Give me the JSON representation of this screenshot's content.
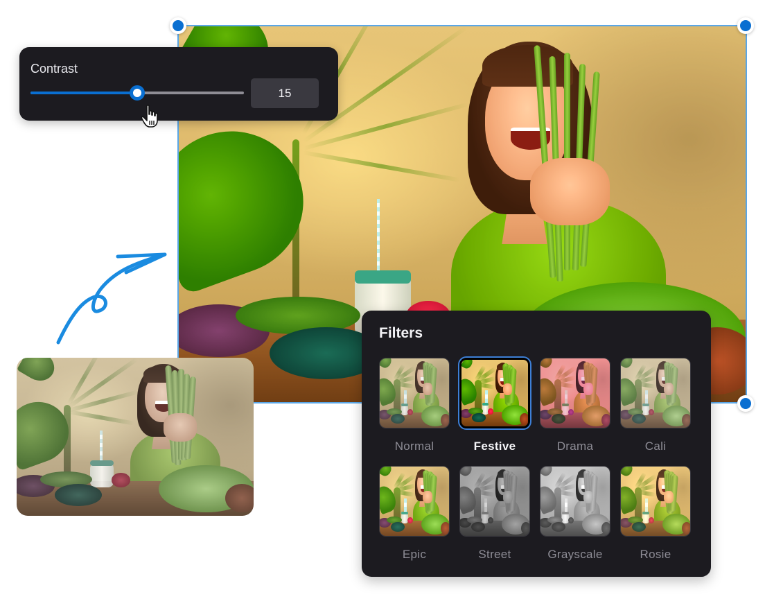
{
  "contrast": {
    "label": "Contrast",
    "value": "15",
    "slider_fraction": 0.5
  },
  "filters": {
    "title": "Filters",
    "selected": "Festive",
    "items": [
      {
        "label": "Normal"
      },
      {
        "label": "Festive"
      },
      {
        "label": "Drama"
      },
      {
        "label": "Cali"
      },
      {
        "label": "Epic"
      },
      {
        "label": "Street"
      },
      {
        "label": "Grayscale"
      },
      {
        "label": "Rosie"
      }
    ]
  },
  "colors": {
    "accent": "#0a6fd1",
    "selection_border": "#5aa6e6",
    "panel_bg": "#1c1b20",
    "doodle": "#1a8be0"
  },
  "icons": {
    "cursor": "hand-pointer-icon",
    "doodle": "curved-arrow-icon",
    "handles": "resize-handle-icon"
  }
}
